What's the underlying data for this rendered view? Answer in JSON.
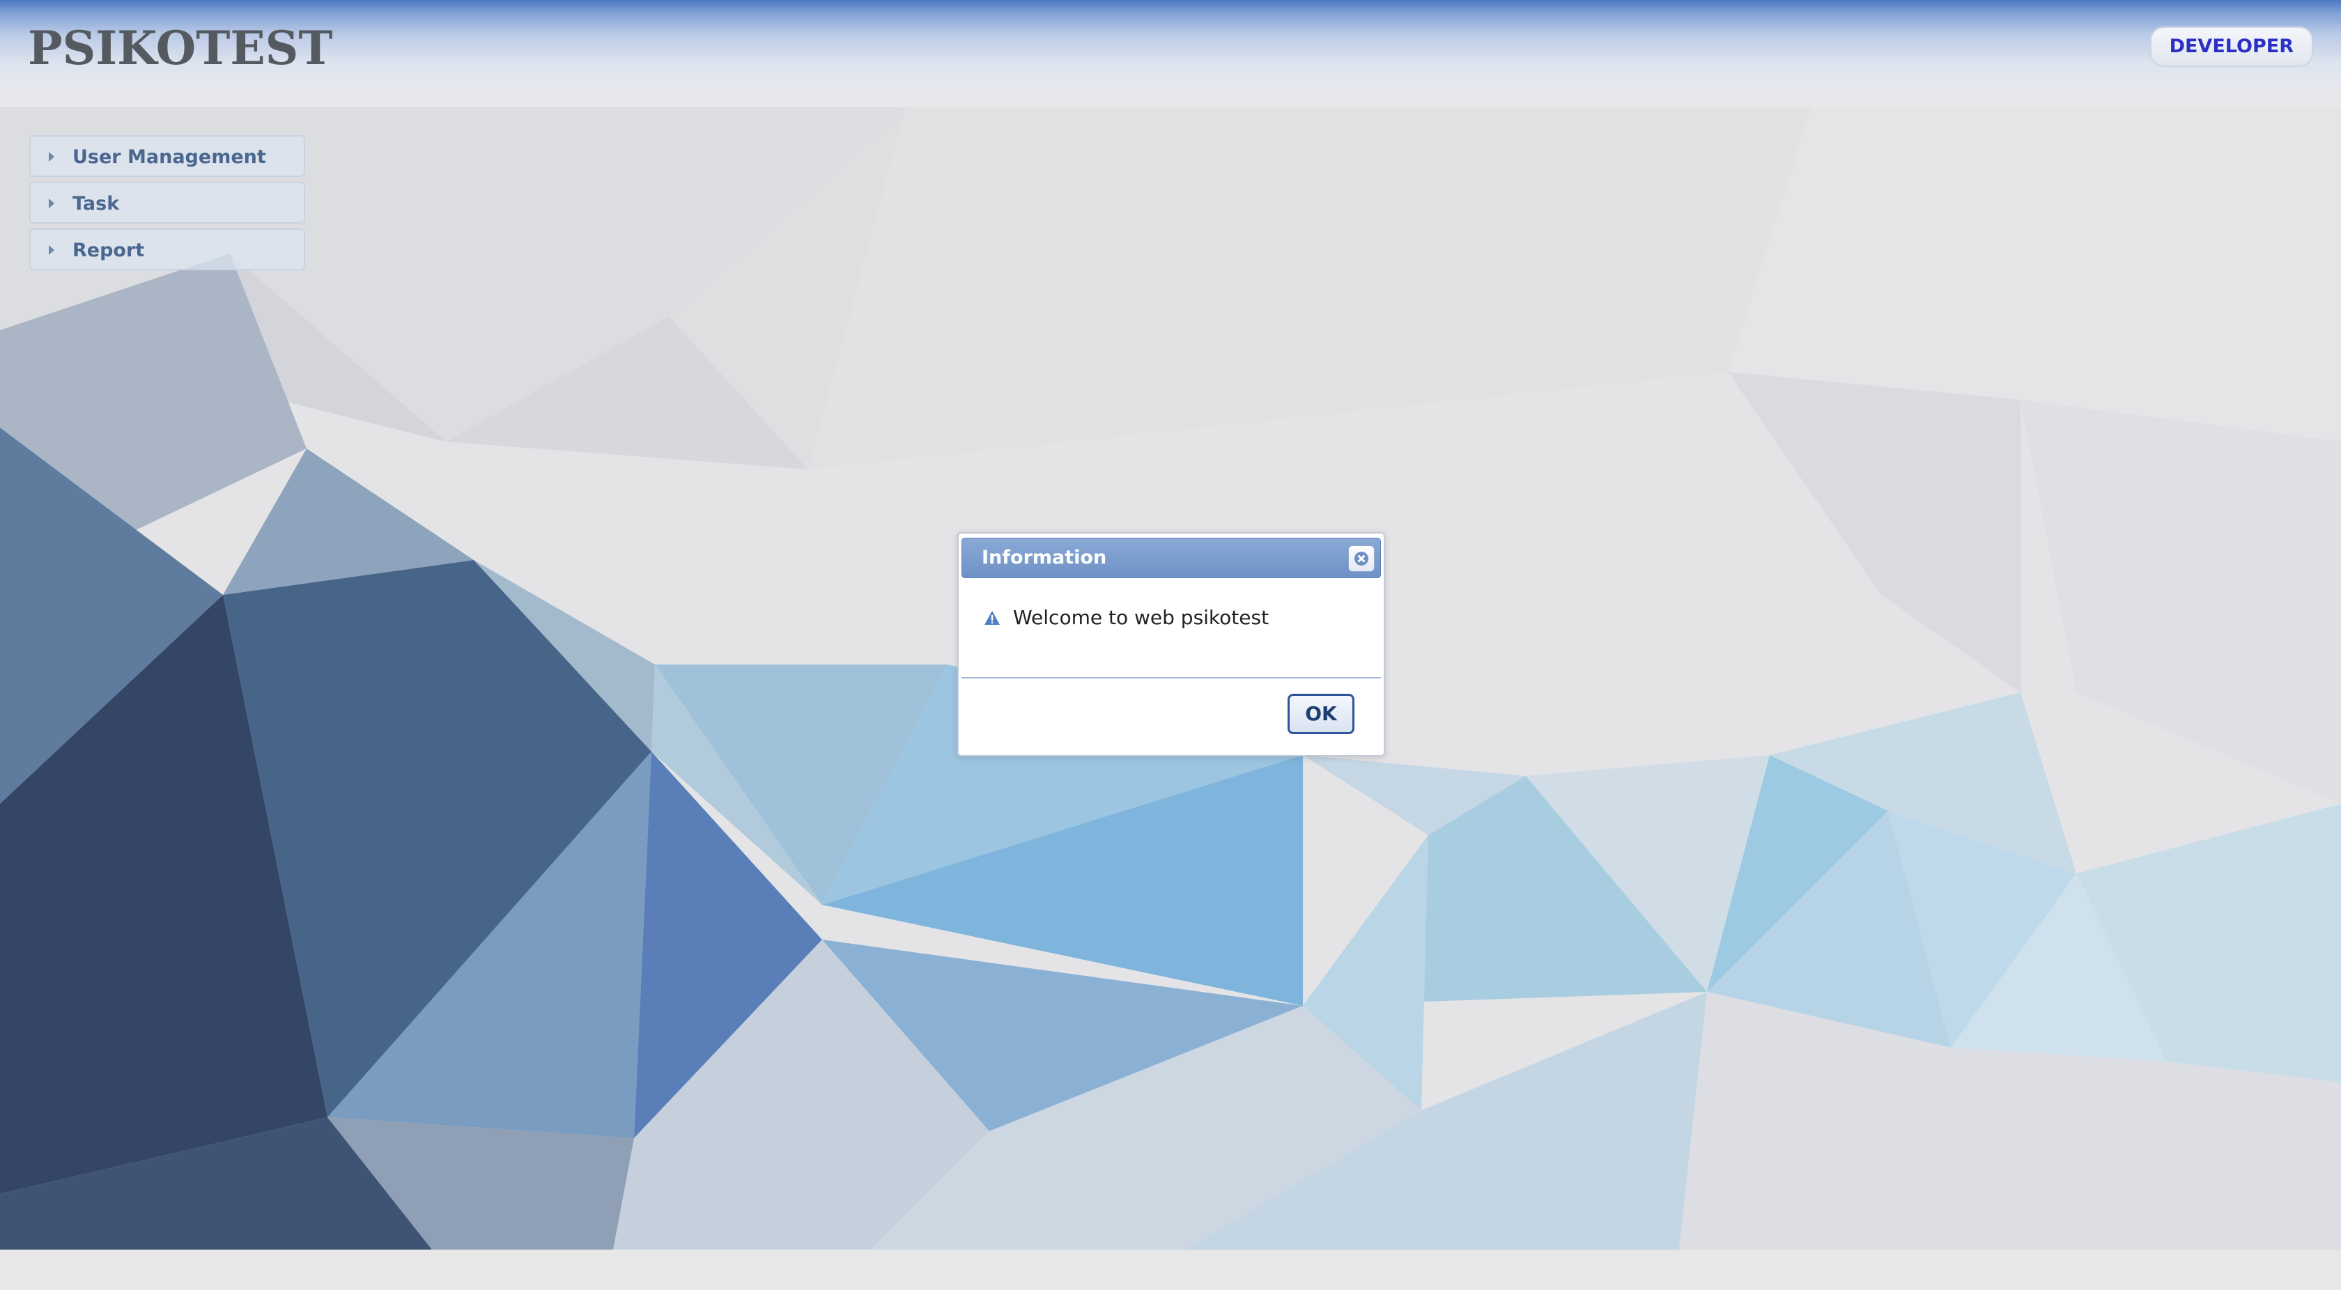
{
  "app": {
    "title": "PSIKOTEST",
    "user_role": "DEVELOPER"
  },
  "menu": {
    "items": [
      {
        "label": "User Management"
      },
      {
        "label": "Task"
      },
      {
        "label": "Report"
      }
    ]
  },
  "dialog": {
    "title": "Information",
    "message": "Welcome to web psikotest",
    "ok_label": "OK",
    "icon": "warning-icon",
    "close_icon": "close-icon"
  },
  "colors": {
    "header_accent": "#4f78c4",
    "user_role_text": "#2b2fc4",
    "menu_text": "#4a6790",
    "dialog_titlebar": "#7898cb",
    "ok_border": "#2e5597"
  }
}
